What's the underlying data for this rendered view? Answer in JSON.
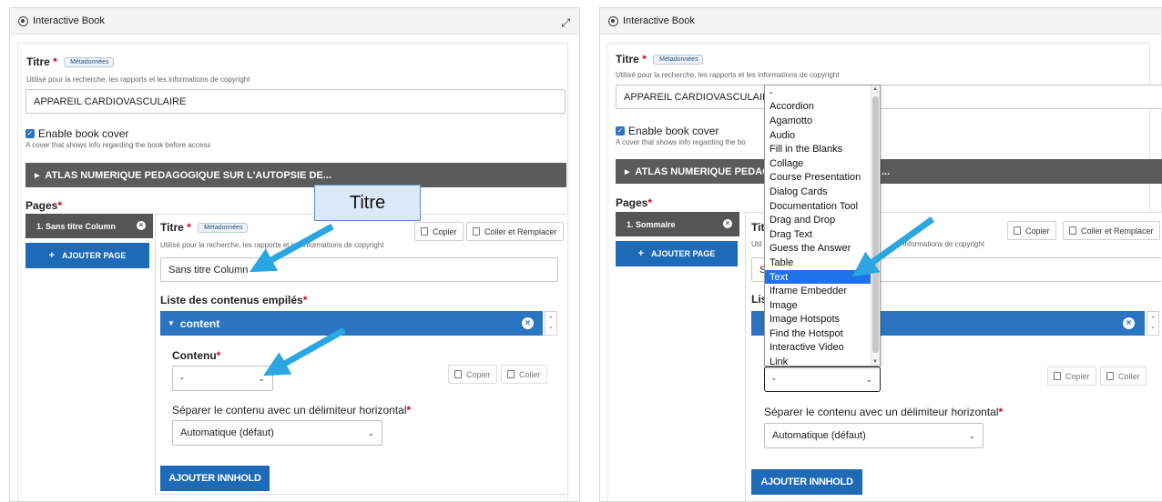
{
  "colors": {
    "primary": "#1d6bb8",
    "content_bar": "#2a74c0",
    "group_bar": "#5b5b5b",
    "page_tab": "#555555",
    "arrow": "#2aa7e3",
    "required": "#d0021b",
    "dropdown_selected": "#1e73e8"
  },
  "icons": [
    "h5p-logo-icon",
    "expand-icon",
    "checkbox-checked-icon",
    "triangle-right-icon",
    "close-circle-icon",
    "plus-icon",
    "copy-icon",
    "paste-icon",
    "chevron-down-icon",
    "chevron-up-icon",
    "arrow-pointer-icon"
  ],
  "left": {
    "header": {
      "title": "Interactive Book"
    },
    "titre": {
      "label": "Titre",
      "required": "*",
      "meta": "Métadonnées",
      "description": "Utilisé pour la recherche, les rapports et les informations de copyright",
      "value": "APPAREIL  CARDIOVASCULAIRE"
    },
    "cover": {
      "label": "Enable book cover",
      "description": "A cover that shows info regarding the book before access"
    },
    "group": {
      "label": "ATLAS NUMERIQUE PEDAGOGIQUE SUR L'AUTOPSIE DE..."
    },
    "pages": {
      "label": "Pages",
      "required": "*",
      "tab": "1. Sans titre Column",
      "add_page": "AJOUTER PAGE"
    },
    "page_editor": {
      "titre_label": "Titre",
      "meta": "Métadonnées",
      "description": "Utilisé pour la recherche, les rapports et les informations de copyright",
      "copy": "Copier",
      "paste_replace": "Coller et Remplacer",
      "value": "Sans titre Column",
      "list_label": "Liste des contenus empilés",
      "content_bar": "content",
      "contenu_label": "Contenu",
      "contenu_value": "-",
      "copy_small": "Copier",
      "paste_small": "Coller",
      "separator_label": "Séparer le contenu avec un délimiteur horizontal",
      "separator_value": "Automatique (défaut)",
      "add_content": "AJOUTER INNHOLD"
    },
    "callout": "Titre"
  },
  "right": {
    "header": {
      "title": "Interactive Book"
    },
    "titre": {
      "label": "Titre",
      "meta": "Métadonnées",
      "description": "Utilisé pour la recherche, les rapports et les informations de copyright",
      "value": "APPAREIL  CARDIOVASCULAIRE"
    },
    "cover": {
      "label": "Enable book cover",
      "description_visible": "A cover that shows info regarding the bo"
    },
    "group": {
      "label_visible": "ATLAS NUMERIQUE PEDAGOG",
      "label_tail": "..."
    },
    "pages": {
      "label": "Pages",
      "tab": "1. Sommaire",
      "add_page": "AJOUTER PAGE"
    },
    "page_editor": {
      "titre_label_visible": "Tit",
      "copy": "Copier",
      "paste_replace": "Coller et Remplacer",
      "description_left": "Util",
      "description_right": "es informations de copyright",
      "value_visible": "S",
      "list_label_visible": "Lis",
      "contenu_value": "-",
      "copy_small": "Copier",
      "paste_small": "Coller",
      "separator_label": "Séparer le contenu avec un délimiteur horizontal",
      "separator_value": "Automatique (défaut)",
      "add_content": "AJOUTER INNHOLD"
    },
    "dropdown": {
      "selected": "Text",
      "options": [
        "-",
        "Accordion",
        "Agamotto",
        "Audio",
        "Fill in the Blanks",
        "Collage",
        "Course Presentation",
        "Dialog Cards",
        "Documentation Tool",
        "Drag and Drop",
        "Drag Text",
        "Guess the Answer",
        "Table",
        "Text",
        "Iframe Embedder",
        "Image",
        "Image Hotspots",
        "Find the Hotspot",
        "Interactive Video",
        "Link"
      ]
    }
  }
}
